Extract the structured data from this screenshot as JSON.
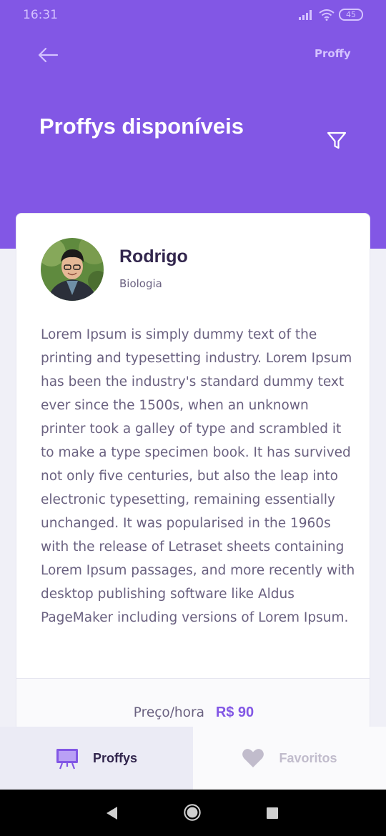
{
  "status": {
    "time": "16:31",
    "battery": "45"
  },
  "header": {
    "brand": "Proffy",
    "title": "Proffys disponíveis"
  },
  "teacher": {
    "name": "Rodrigo",
    "subject": "Biologia",
    "bio": "Lorem Ipsum is simply dummy text of the printing and typesetting industry. Lorem Ipsum has been the industry's standard dummy text ever since the 1500s, when an unknown printer took a galley of type and scrambled it to make a type specimen book. It has survived not only five centuries, but also the leap into electronic typesetting, remaining essentially unchanged. It was popularised in the 1960s with the release of Letraset sheets containing Lorem Ipsum passages, and more recently with desktop publishing software like Aldus PageMaker including versions of Lorem Ipsum.",
    "price_label": "Preço/hora",
    "price_value": "R$  90"
  },
  "tabs": [
    {
      "label": "Proffys",
      "icon": "easel-icon",
      "active": true
    },
    {
      "label": "Favoritos",
      "icon": "heart-icon",
      "active": false
    }
  ],
  "colors": {
    "primary": "#8257E5",
    "title_text": "#32264D",
    "body_text": "#6A6180",
    "inactive": "#C1BCCC"
  }
}
